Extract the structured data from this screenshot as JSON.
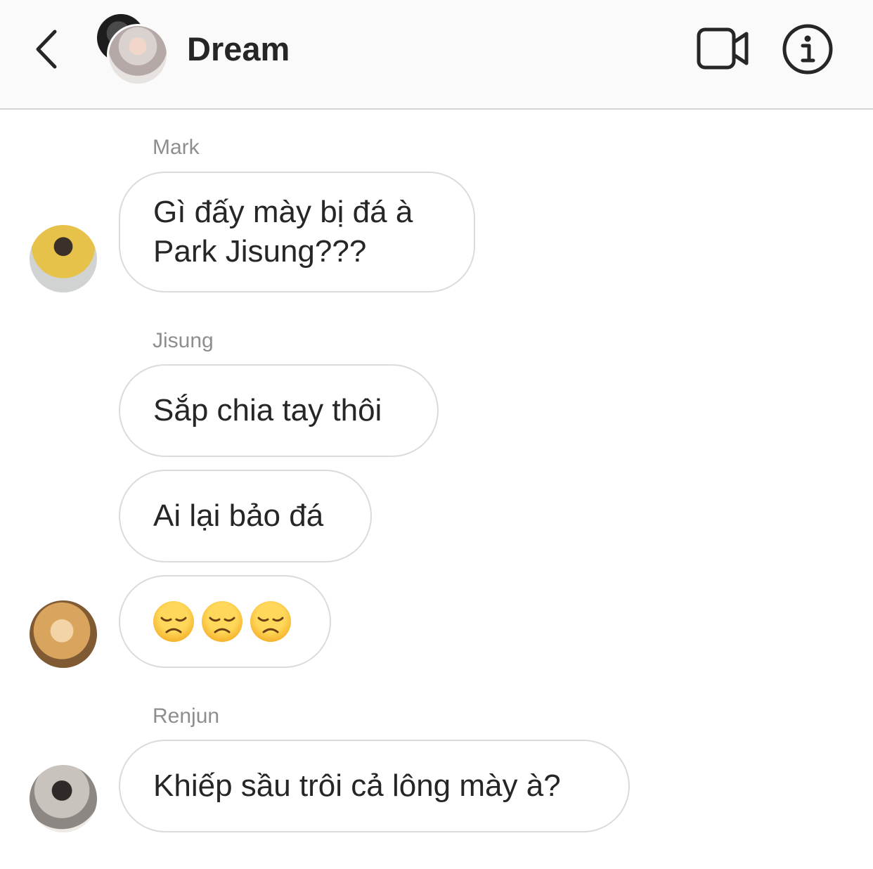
{
  "header": {
    "title": "Dream",
    "back_icon": "chevron-left-icon",
    "video_icon": "video-camera-icon",
    "info_icon": "info-icon"
  },
  "messages": [
    {
      "sender": "Mark",
      "text_line1": "Gì đấy mày bị đá à",
      "text_line2": "Park Jisung???"
    },
    {
      "sender": "Jisung",
      "texts": [
        "Sắp chia tay thôi",
        "Ai lại bảo đá"
      ],
      "emoji_name": "disappointed-face-icon",
      "emoji_count": 3
    },
    {
      "sender": "Renjun",
      "text": "Khiếp sầu trôi cả lông mày à?"
    }
  ],
  "colors": {
    "header_bg": "#fafafa",
    "text": "#262626",
    "sender": "#8e8e8e",
    "bubble_border": "#dbdbdb"
  }
}
